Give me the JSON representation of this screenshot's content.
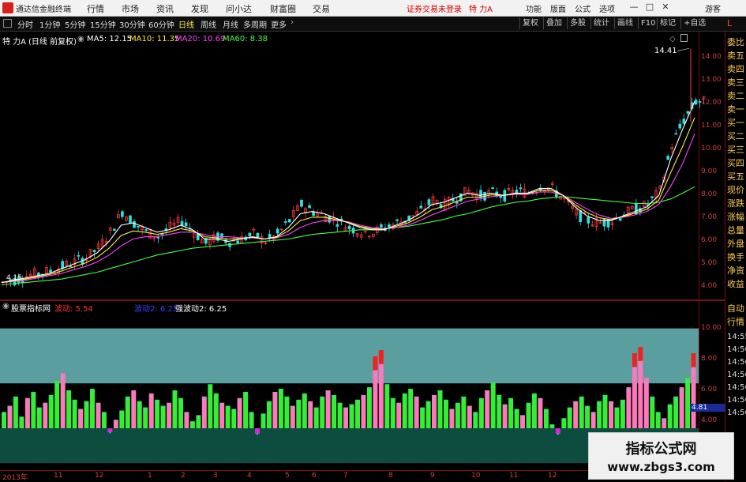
{
  "titlebar": {
    "app_name": "通达信金融终端",
    "menus": [
      "行情",
      "市场",
      "资讯",
      "发现",
      "问小达",
      "财富圈",
      "交易"
    ],
    "notice": "证券交易未登录",
    "stock": "特 力A",
    "right_menus": [
      "功能",
      "版面",
      "公式",
      "选项"
    ],
    "user": "游客",
    "window_buttons": [
      "—",
      "□",
      "✕"
    ]
  },
  "periodbar": {
    "periods": [
      "分时",
      "1分钟",
      "5分钟",
      "15分钟",
      "30分钟",
      "60分钟",
      "日线",
      "周线",
      "月线",
      "多周期",
      "更多"
    ],
    "selected": "日线",
    "tools": [
      "复权",
      "叠加",
      "多股",
      "统计",
      "画线",
      "F10",
      "标记",
      "+自选"
    ]
  },
  "price_chart": {
    "title": "特 力A",
    "subtitle": "(日线 前复权)",
    "ma": [
      {
        "label": "MA5: 12.15",
        "color": "#ffffff"
      },
      {
        "label": "MA10: 11.35",
        "color": "#ffee33"
      },
      {
        "label": "MA20: 10.69",
        "color": "#ff44ff"
      },
      {
        "label": "MA60: 8.38",
        "color": "#44ff44"
      }
    ],
    "high_label": "14.41",
    "low_label": "4.15",
    "y_ticks": [
      "14.00",
      "13.00",
      "12.00",
      "11.00",
      "10.00",
      "9.00",
      "8.00",
      "7.00",
      "6.00",
      "5.00",
      "4.00"
    ],
    "y_range": [
      3.6,
      14.8
    ],
    "closes": [
      4.2,
      4.3,
      4.5,
      4.6,
      4.7,
      4.9,
      5.1,
      5.3,
      5.7,
      6.4,
      7.3,
      6.8,
      6.4,
      6.2,
      6.6,
      6.9,
      6.4,
      5.9,
      6.2,
      6.0,
      6.1,
      6.3,
      6.0,
      6.3,
      6.9,
      7.6,
      7.3,
      7.1,
      6.9,
      6.6,
      6.4,
      6.4,
      6.6,
      6.8,
      7.0,
      7.3,
      7.8,
      7.6,
      7.9,
      8.2,
      8.0,
      8.1,
      8.0,
      8.2,
      8.1,
      8.4,
      8.3,
      7.8,
      7.2,
      6.9,
      6.8,
      6.9,
      7.2,
      7.4,
      7.6,
      8.2,
      10.2,
      11.3,
      12.1
    ],
    "ma5": [
      4.2,
      4.3,
      4.4,
      4.5,
      4.6,
      4.8,
      5.0,
      5.2,
      5.5,
      6.0,
      6.7,
      6.8,
      6.6,
      6.4,
      6.5,
      6.7,
      6.5,
      6.1,
      6.1,
      6.0,
      6.1,
      6.2,
      6.1,
      6.2,
      6.6,
      7.2,
      7.3,
      7.2,
      7.0,
      6.8,
      6.6,
      6.5,
      6.5,
      6.7,
      6.9,
      7.2,
      7.6,
      7.7,
      7.9,
      8.1,
      8.0,
      8.1,
      8.0,
      8.1,
      8.1,
      8.3,
      8.3,
      8.0,
      7.5,
      7.1,
      6.9,
      6.9,
      7.1,
      7.3,
      7.5,
      8.0,
      9.6,
      10.9,
      12.1
    ],
    "ma20": [
      4.2,
      4.25,
      4.3,
      4.4,
      4.5,
      4.6,
      4.75,
      4.9,
      5.1,
      5.4,
      5.8,
      6.1,
      6.2,
      6.2,
      6.3,
      6.4,
      6.4,
      6.3,
      6.2,
      6.2,
      6.15,
      6.15,
      6.1,
      6.15,
      6.3,
      6.6,
      6.8,
      6.9,
      6.9,
      6.85,
      6.7,
      6.6,
      6.55,
      6.6,
      6.7,
      6.9,
      7.15,
      7.35,
      7.55,
      7.75,
      7.85,
      7.95,
      8.0,
      8.05,
      8.05,
      8.15,
      8.15,
      8.0,
      7.7,
      7.4,
      7.15,
      7.0,
      7.05,
      7.15,
      7.3,
      7.6,
      8.4,
      9.4,
      10.69
    ],
    "ma60": [
      4.1,
      4.15,
      4.2,
      4.25,
      4.3,
      4.35,
      4.45,
      4.55,
      4.65,
      4.8,
      4.95,
      5.1,
      5.25,
      5.4,
      5.5,
      5.6,
      5.7,
      5.75,
      5.8,
      5.85,
      5.9,
      5.95,
      6.0,
      6.05,
      6.1,
      6.2,
      6.3,
      6.35,
      6.4,
      6.45,
      6.5,
      6.5,
      6.55,
      6.6,
      6.65,
      6.75,
      6.85,
      6.95,
      7.1,
      7.2,
      7.35,
      7.5,
      7.6,
      7.7,
      7.75,
      7.85,
      7.9,
      7.95,
      7.9,
      7.85,
      7.8,
      7.75,
      7.7,
      7.65,
      7.65,
      7.7,
      7.85,
      8.1,
      8.38
    ]
  },
  "indicator": {
    "title": "股票指标网",
    "labels": [
      {
        "text": "波动: 5.54",
        "color": "#ff3333"
      },
      {
        "text": "波动2: 6.25",
        "color": "#3344ff"
      },
      {
        "text": "强波动2: 6.25",
        "color": "#ffffff"
      }
    ],
    "y_ticks": [
      "10.00",
      "8.00",
      "6.00",
      "4.00",
      "4.81"
    ],
    "times": [
      "14:55",
      "14:56",
      "14:56",
      "14:56",
      "14:56",
      "14:56",
      "14:56"
    ],
    "y_range": [
      1.0,
      11.0
    ],
    "upper_band": [
      6.45,
      10.0
    ],
    "lower_band": [
      1.3,
      3.55
    ],
    "mid_value": 3.55,
    "marker": "4.81",
    "colors": {
      "upper": "#5b9ea0",
      "lower": "#0c4d40",
      "bar_green": "#33ee33",
      "bar_pink": "#ff77bb",
      "peak_red": "#ee2222",
      "peak_magenta": "#dd22dd",
      "dot": "#33ddff"
    },
    "bars": [
      4.6,
      5.0,
      5.6,
      4.3,
      5.5,
      5.9,
      4.9,
      5.2,
      5.7,
      6.6,
      7.1,
      6.0,
      5.4,
      4.8,
      5.3,
      6.1,
      5.2,
      4.6,
      3.3,
      4.1,
      4.7,
      5.6,
      6.0,
      5.3,
      4.9,
      5.8,
      5.4,
      5.0,
      5.2,
      6.0,
      5.5,
      4.6,
      4.0,
      4.4,
      5.6,
      6.4,
      5.8,
      5.2,
      5.0,
      4.8,
      5.5,
      5.9,
      4.6,
      3.2,
      4.5,
      5.3,
      5.9,
      6.1,
      5.6,
      5.0,
      5.4,
      5.8,
      5.3,
      4.9,
      5.6,
      6.0,
      5.7,
      5.2,
      4.9,
      5.1,
      5.4,
      5.7,
      6.2,
      7.3,
      7.7,
      6.4,
      5.5,
      5.2,
      5.8,
      6.1,
      5.6,
      4.9,
      5.3,
      5.7,
      6.0,
      5.4,
      4.8,
      5.2,
      5.6,
      5.0,
      4.6,
      5.5,
      6.0,
      6.5,
      5.7,
      5.1,
      5.5,
      4.8,
      4.4,
      5.2,
      5.8,
      5.5,
      4.8,
      3.8,
      3.2,
      4.2,
      4.9,
      5.3,
      5.6,
      5.0,
      4.6,
      5.3,
      5.7,
      5.3,
      4.9,
      5.4,
      6.2,
      7.5,
      7.9,
      6.8,
      5.6,
      4.6,
      4.2,
      5.1,
      5.6,
      6.2,
      6.8,
      7.5
    ]
  },
  "date_axis": {
    "labels": [
      "2013年",
      "11",
      "12",
      "1",
      "2",
      "3",
      "4",
      "5",
      "6",
      "7",
      "8",
      "9",
      "10",
      "11",
      "12"
    ]
  },
  "watermark": {
    "text": "指标公式网",
    "url": "www.zbgs3.com"
  },
  "side_panel": {
    "items": [
      "L",
      "委比",
      "卖五",
      "卖四",
      "卖三",
      "卖二",
      "卖一",
      "买一",
      "买二",
      "买三",
      "买四",
      "买五",
      "现价",
      "涨跌",
      "涨幅",
      "总量",
      "外盘",
      "换手",
      "净资",
      "收益",
      "自动",
      "行情"
    ]
  }
}
